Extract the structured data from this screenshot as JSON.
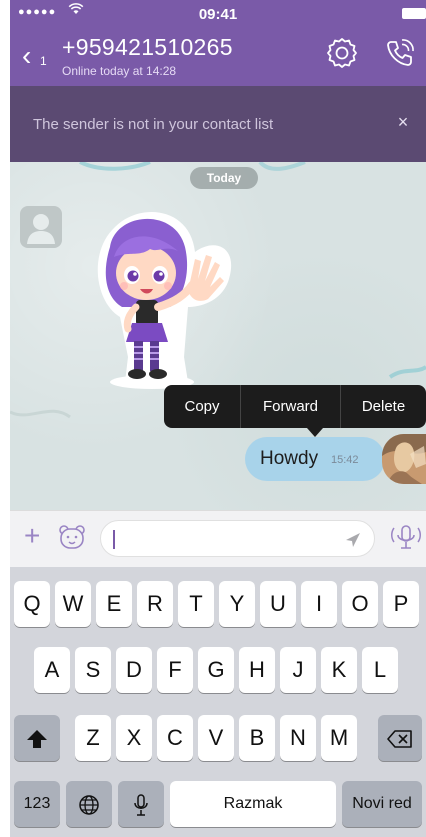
{
  "status_bar": {
    "signal": "●●●●●",
    "time": "09:41"
  },
  "header": {
    "back_count": "1",
    "contact_name": "+959421510265",
    "contact_status": "Online today at 14:28"
  },
  "notice": {
    "text": "The sender is not in your contact list",
    "close": "×"
  },
  "chat": {
    "date_label": "Today",
    "context_menu": {
      "copy": "Copy",
      "forward": "Forward",
      "delete": "Delete"
    },
    "outgoing_message": {
      "text": "Howdy",
      "time": "15:42"
    }
  },
  "composer": {
    "plus": "+"
  },
  "keyboard": {
    "row1": [
      "Q",
      "W",
      "E",
      "R",
      "T",
      "Y",
      "U",
      "I",
      "O",
      "P"
    ],
    "row2": [
      "A",
      "S",
      "D",
      "F",
      "G",
      "H",
      "J",
      "K",
      "L"
    ],
    "row3": [
      "Z",
      "X",
      "C",
      "V",
      "B",
      "N",
      "M"
    ],
    "numbers_key": "123",
    "space_key": "Razmak",
    "return_key": "Novi red"
  },
  "colors": {
    "header": "#7a5aa8",
    "notice": "#5b4a72",
    "bubble": "#a8d3ea",
    "chat_background": "#d8e2e2",
    "keyboard": "#d3d5db"
  }
}
